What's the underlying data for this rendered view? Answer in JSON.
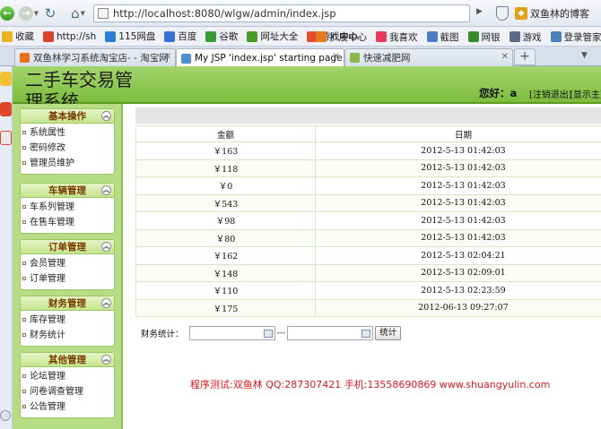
{
  "browser": {
    "url_host": "http://localhost",
    "url_path": ":8080/wlgw/admin/index.jsp",
    "profile_text": "双鱼林的博客",
    "bookmarks_left": [
      {
        "label": "收藏",
        "icon": "star-icon",
        "color": "#e8b321"
      },
      {
        "label": "http://sh",
        "icon": "link-icon",
        "color": "#d9432b"
      },
      {
        "label": "115网盘",
        "icon": "cloud-icon",
        "color": "#2a7fd4"
      },
      {
        "label": "百度",
        "icon": "baidu-icon",
        "color": "#3a6fd8"
      },
      {
        "label": "谷歌",
        "icon": "google-icon",
        "color": "#3b9b3b"
      },
      {
        "label": "网址大全",
        "icon": "globe-icon",
        "color": "#4a9a2a"
      },
      {
        "label": "游戏中心",
        "icon": "game-icon",
        "color": "#e24d2b"
      }
    ],
    "bookmarks_right": [
      {
        "label": "扩展中心",
        "icon": "puzzle-icon",
        "color": "#e57a1e"
      },
      {
        "label": "我喜欢",
        "icon": "heart-icon",
        "color": "#e83a5e"
      },
      {
        "label": "截图",
        "icon": "scissors-icon",
        "color": "#4d7cc2"
      },
      {
        "label": "网银",
        "icon": "bank-icon",
        "color": "#3d8a2e"
      },
      {
        "label": "游戏",
        "icon": "controller-icon",
        "color": "#5c6c84"
      },
      {
        "label": "登录管家(6)",
        "icon": "key-icon",
        "color": "#4b7fb8"
      }
    ],
    "tabs": [
      {
        "label": "双鱼林学习系统淘宝店- - 淘宝网",
        "active": false,
        "color": "#e8731c"
      },
      {
        "label": "My JSP 'index.jsp' starting page",
        "active": true,
        "color": "#4e8fd1"
      },
      {
        "label": "快速减肥网",
        "active": false,
        "color": "#8ab54c"
      }
    ]
  },
  "header": {
    "title": "二手车交易管",
    "title2": "理系统",
    "greeting_prefix": "您好：",
    "user": "a",
    "logout": "[注销退出]",
    "show_home": "[显示主页]"
  },
  "sidebar": {
    "sections": [
      {
        "title": "基本操作",
        "items": [
          "系统属性",
          "密码修改",
          "管理员维护"
        ]
      },
      {
        "title": "车辆管理",
        "items": [
          "车系列管理",
          "在售车管理"
        ]
      },
      {
        "title": "订单管理",
        "items": [
          "会员管理",
          "订单管理"
        ]
      },
      {
        "title": "财务管理",
        "items": [
          "库存管理",
          "财务统计"
        ]
      },
      {
        "title": "其他管理",
        "items": [
          "论坛管理",
          "问卷调查管理",
          "公告管理"
        ]
      }
    ]
  },
  "table": {
    "headers": [
      "金额",
      "日期"
    ],
    "rows": [
      [
        "￥163",
        "2012-5-13 01:42:03"
      ],
      [
        "￥118",
        "2012-5-13 01:42:03"
      ],
      [
        "￥0",
        "2012-5-13 01:42:03"
      ],
      [
        "￥543",
        "2012-5-13 01:42:03"
      ],
      [
        "￥98",
        "2012-5-13 01:42:03"
      ],
      [
        "￥80",
        "2012-5-13 01:42:03"
      ],
      [
        "￥162",
        "2012-5-13 02:04:21"
      ],
      [
        "￥148",
        "2012-5-13 02:09:01"
      ],
      [
        "￥110",
        "2012-5-13 02:23:59"
      ],
      [
        "￥175",
        "2012-06-13 09:27:07"
      ]
    ]
  },
  "stats": {
    "label": "财务统计：",
    "separator": "---",
    "button": "统计",
    "start_value": "",
    "end_value": ""
  },
  "credits": "程序测试:双鱼林 QQ:287307421 手机:13558690869 www.shuangyulin.com"
}
